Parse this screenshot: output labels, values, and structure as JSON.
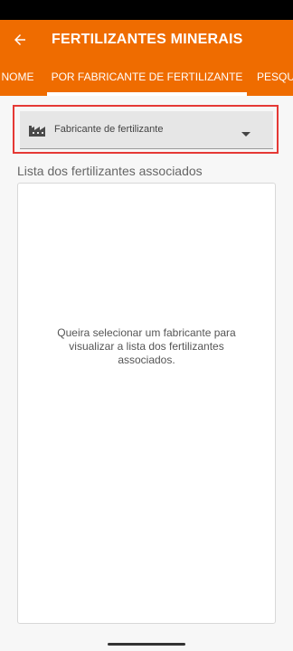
{
  "app_bar": {
    "back_icon": "arrow-back-icon",
    "title": "FERTILIZANTES MINERAIS"
  },
  "tabs": [
    {
      "label": "NOME",
      "selected": false
    },
    {
      "label": "POR FABRICANTE DE FERTILIZANTE",
      "selected": true
    },
    {
      "label": "PESQU",
      "selected": false
    }
  ],
  "manufacturer_select": {
    "icon": "factory-icon",
    "label": "Fabricante de fertilizante",
    "selected_value": ""
  },
  "list": {
    "title": "Lista dos fertilizantes associados",
    "empty_message": "Queira selecionar um fabricante para visualizar a lista dos fertilizantes associados."
  },
  "colors": {
    "primary": "#ef6c00",
    "highlight": "#e53935"
  }
}
